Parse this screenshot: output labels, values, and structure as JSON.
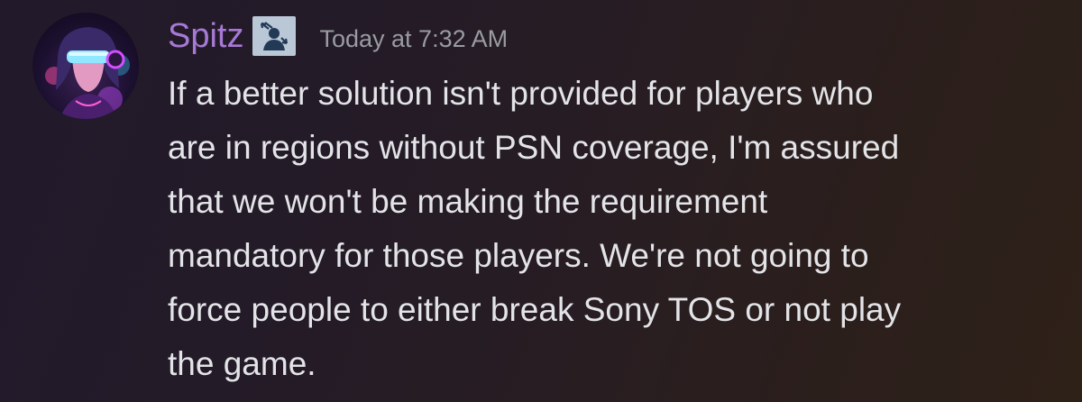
{
  "message": {
    "author": "Spitz",
    "timestamp": "Today at 7:32 AM",
    "lines": [
      "If a better solution isn't provided for players who",
      "are in regions without PSN coverage, I'm assured",
      "that we won't be making the requirement",
      "mandatory for those players. We're not going to",
      "force people to either break Sony TOS or not play",
      "the game."
    ]
  },
  "icons": {
    "avatar": "avatar-image",
    "badge": "role-badge-icon"
  },
  "colors": {
    "username": "#a779d6",
    "timestamp": "#9a9ba1",
    "body_text": "#e3e4e8",
    "badge_bg": "#b9c7d6",
    "badge_fg": "#233a56"
  }
}
